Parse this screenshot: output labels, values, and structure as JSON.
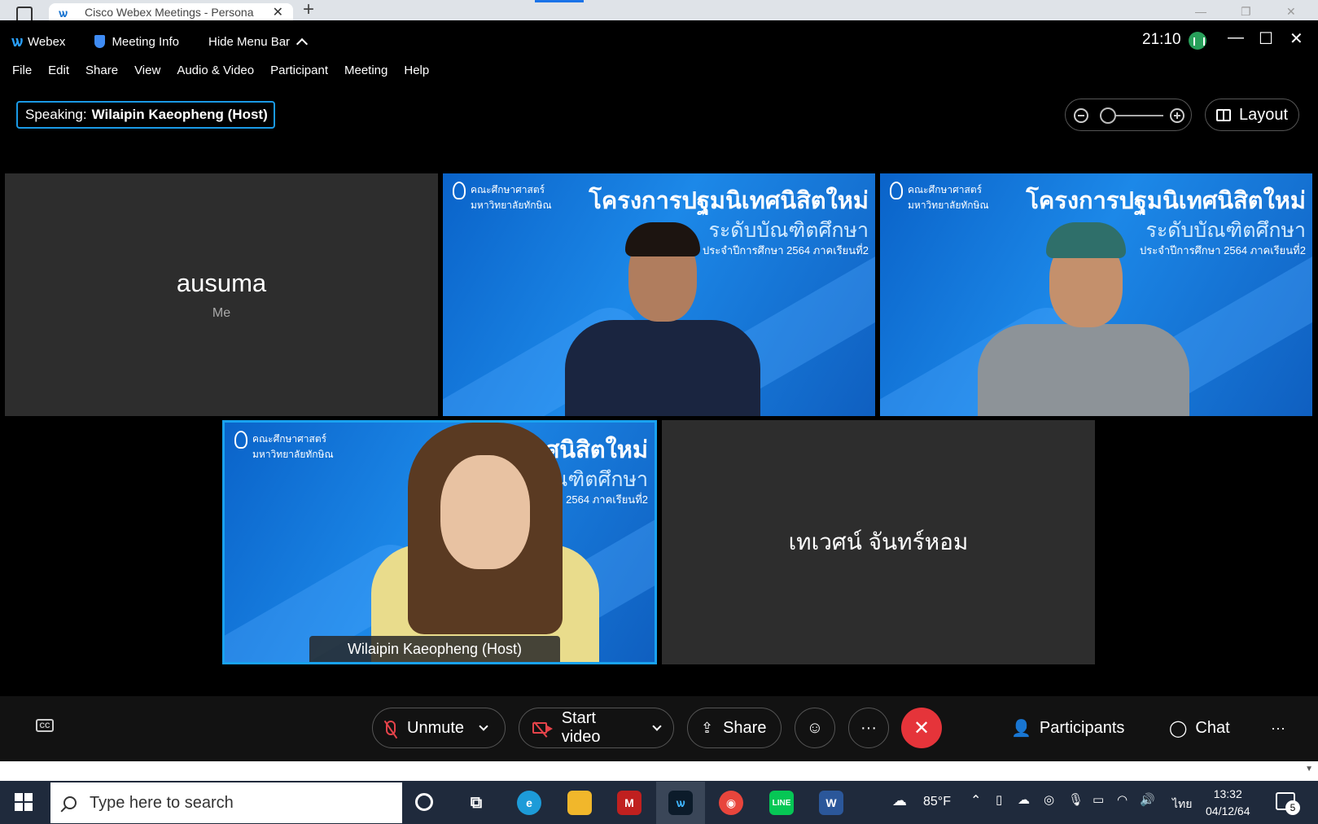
{
  "browser": {
    "tab_title": "Cisco Webex Meetings - Persona",
    "new_tab": "+",
    "close_tab": "✕"
  },
  "header": {
    "app_name": "Webex",
    "meeting_info": "Meeting Info",
    "hide_menu_bar": "Hide Menu Bar",
    "clock": "21:10"
  },
  "menu": [
    "File",
    "Edit",
    "Share",
    "View",
    "Audio & Video",
    "Participant",
    "Meeting",
    "Help"
  ],
  "speaking": {
    "label": "Speaking:",
    "name": "Wilaipin Kaeopheng (Host)"
  },
  "view_controls": {
    "layout_label": "Layout",
    "zoom_level": 0.0
  },
  "tiles": {
    "me": {
      "name": "ausuma",
      "sub": "Me"
    },
    "banner": {
      "faculty": "คณะศึกษาศาสตร์",
      "university": "มหาวิทยาลัยทักษิณ",
      "line1": "โครงการปฐมนิเทศนิสิตใหม่",
      "line2": "ระดับบัณฑิตศึกษา",
      "line3": "ประจำปีการศึกษา 2564 ภาคเรียนที่2"
    },
    "host": {
      "name": "Wilaipin Kaeopheng (Host)",
      "banner_line1": "นิเทศนิสิตใหม่",
      "banner_line2": "บัณฑิตศึกษา",
      "banner_line3": "ารศึกษา 2564 ภาคเรียนที่2"
    },
    "other": {
      "name": "เทเวศน์ จันทร์หอม"
    }
  },
  "controls": {
    "unmute": "Unmute",
    "start_video": "Start video",
    "share": "Share",
    "more": "···",
    "participants": "Participants",
    "chat": "Chat",
    "overflow": "···",
    "cc": "CC"
  },
  "taskbar": {
    "search_placeholder": "Type here to search",
    "weather": "85°F",
    "lang": "ไทย",
    "time": "13:32",
    "date": "04/12/64",
    "notifications": "5"
  },
  "colors": {
    "accent_blue": "#1a9ae6",
    "leave_red": "#e5343a",
    "muted_red": "#e5434a",
    "tile_bg": "#2d2d2d"
  }
}
